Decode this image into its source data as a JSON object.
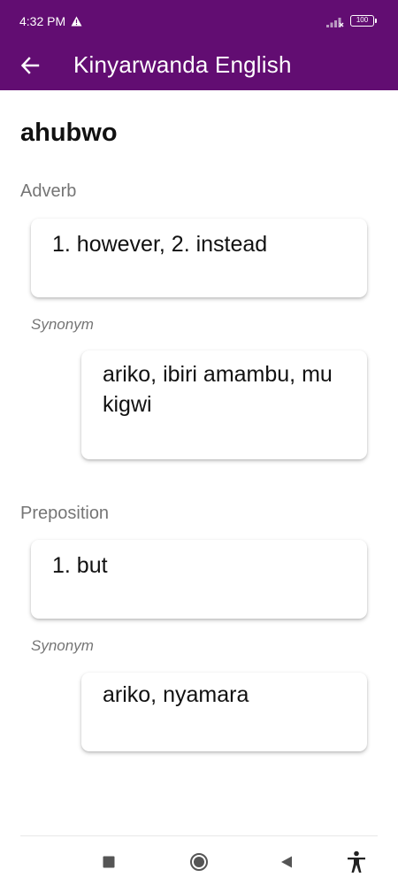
{
  "status_bar": {
    "time": "4:32 PM",
    "battery": "100",
    "icons": [
      "warning-icon",
      "signal-icon",
      "battery-icon"
    ]
  },
  "app_bar": {
    "title": "Kinyarwanda English",
    "back_icon": "arrow-left-icon",
    "background": "#620d72"
  },
  "entry": {
    "headword": "ahubwo",
    "senses": [
      {
        "part_of_speech": "Adverb",
        "definition": "1. however, 2. instead",
        "synonym_label": "Synonym",
        "synonyms": "ariko, ibiri amambu, mu kigwi"
      },
      {
        "part_of_speech": "Preposition",
        "definition": "1. but",
        "synonym_label": "Synonym",
        "synonyms": "ariko, nyamara"
      }
    ]
  },
  "nav_bar": {
    "icons": [
      "recents-square-icon",
      "home-circle-icon",
      "back-triangle-icon",
      "accessibility-icon"
    ]
  }
}
